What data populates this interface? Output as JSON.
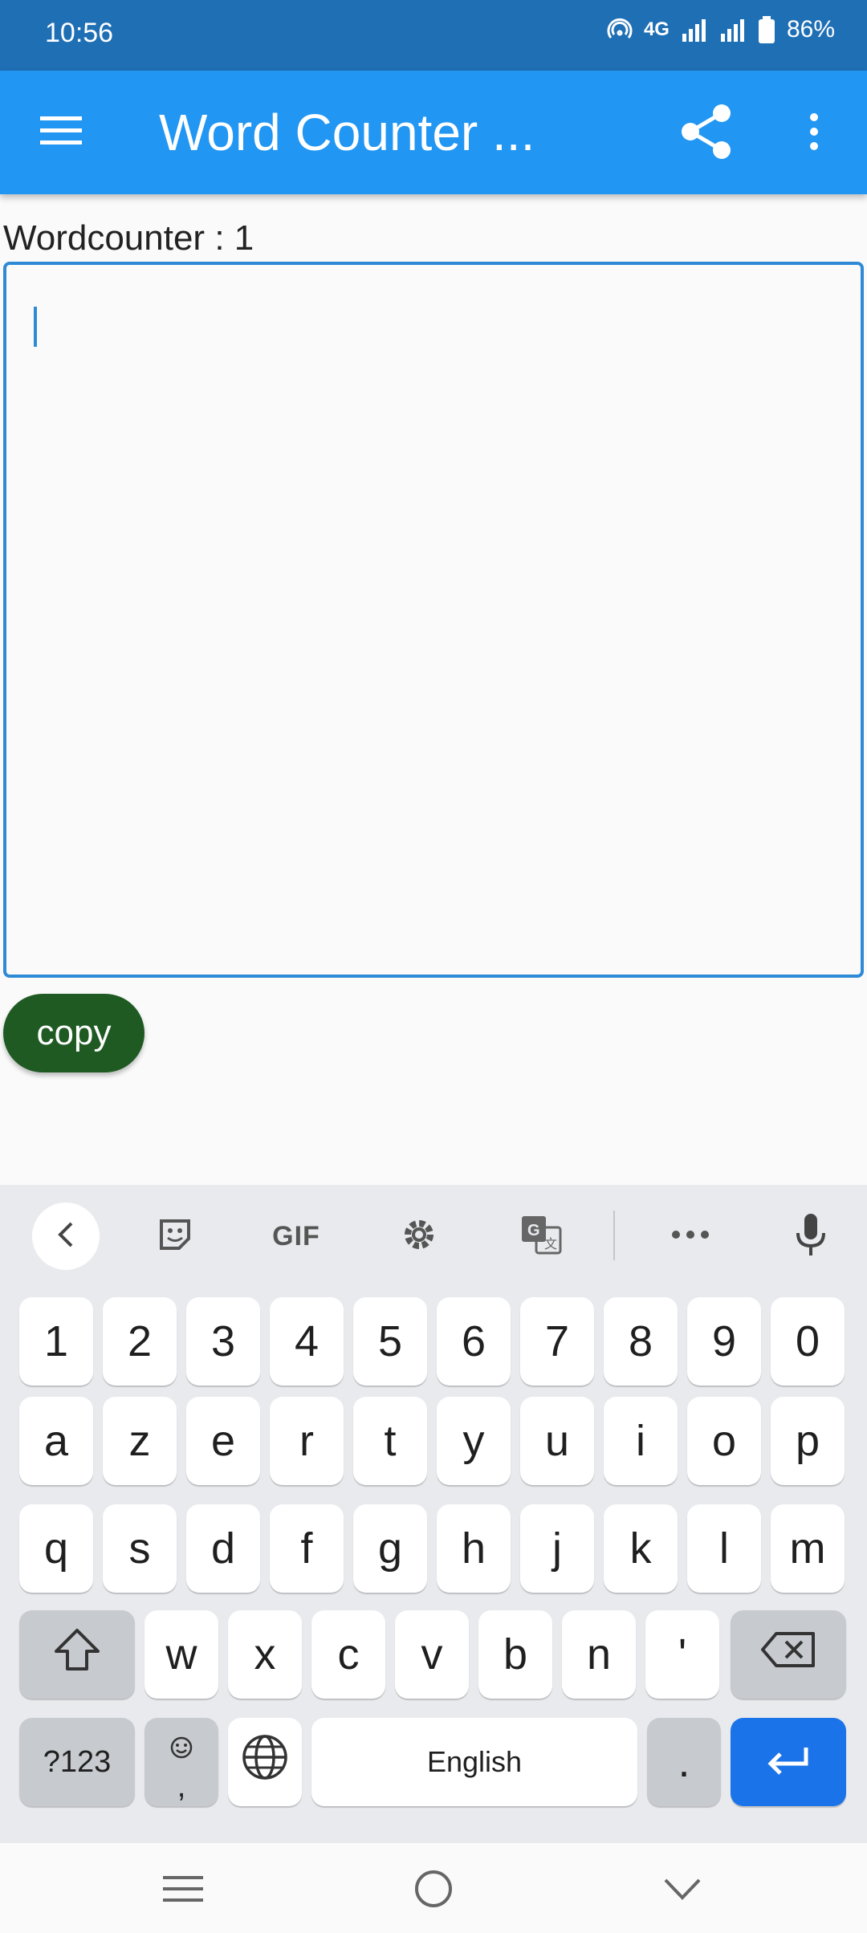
{
  "status_bar": {
    "time": "10:56",
    "network": "4G",
    "battery": "86%"
  },
  "app_bar": {
    "title": "Word Counter ...",
    "icons": [
      "menu-icon",
      "share-icon",
      "more-vert-icon"
    ]
  },
  "main": {
    "word_count_label": "Wordcounter : 1",
    "text_input_value": "",
    "copy_label": "copy"
  },
  "keyboard": {
    "toolbar": {
      "gif_label": "GIF",
      "icons": [
        "back-icon",
        "sticker-icon",
        "gif-icon",
        "settings-icon",
        "translate-icon",
        "more-icon",
        "mic-icon"
      ]
    },
    "row_numbers": [
      "1",
      "2",
      "3",
      "4",
      "5",
      "6",
      "7",
      "8",
      "9",
      "0"
    ],
    "row1": [
      "a",
      "z",
      "e",
      "r",
      "t",
      "y",
      "u",
      "i",
      "o",
      "p"
    ],
    "row2": [
      "q",
      "s",
      "d",
      "f",
      "g",
      "h",
      "j",
      "k",
      "l",
      "m"
    ],
    "row3": [
      "w",
      "x",
      "c",
      "v",
      "b",
      "n",
      "'"
    ],
    "symbols_label": "?123",
    "emoji_comma": ",",
    "space_label": "English",
    "period_label": "."
  },
  "colors": {
    "status_bar": "#1f6fb5",
    "app_bar": "#2196f3",
    "text_border": "#2f8ad6",
    "copy_button": "#1e5a22",
    "enter_key": "#1a73e8"
  }
}
